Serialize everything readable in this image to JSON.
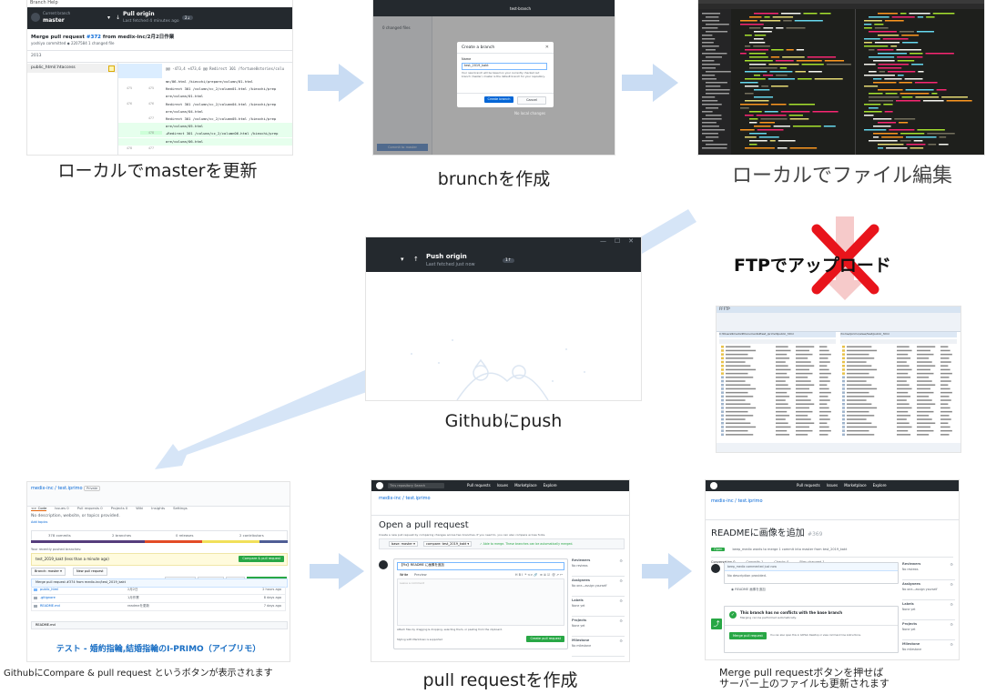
{
  "steps": [
    {
      "id": "local-master",
      "caption": "ローカルでmasterを更新"
    },
    {
      "id": "create-branch",
      "caption": "brunchを作成"
    },
    {
      "id": "edit-files",
      "caption": "ローカルでファイル編集"
    },
    {
      "id": "push",
      "caption": "Githubにpush"
    },
    {
      "id": "compare-button",
      "caption": "GithubにCompare & pull request というボタンが表示されます"
    },
    {
      "id": "create-pr",
      "caption": "pull requestを作成"
    },
    {
      "id": "merge",
      "caption_line1": "Merge pull requestボタンを押せば",
      "caption_line2": "サーバー上のファイルも更新されます"
    }
  ],
  "ftp_label": "FTPでアップロード",
  "shot1": {
    "menu": "Branch   Help",
    "current_repo_label": "Current branch",
    "branch": "master",
    "pull_origin": "Pull origin",
    "fetched": "Last fetched 4 minutes ago",
    "badge": "2↓",
    "commit_title_pre": "Merge pull request ",
    "commit_link": "#372",
    "commit_title_post": " from medix-inc/2月2日作業",
    "commit_meta": "yoshiya committed   ◆ 2207584   1 changed file",
    "year": "2013",
    "file": "public_html/.htaccess",
    "diff_header": "@@ -473,4 +473,6 @@ Redirect 301  /fortune8stories/colu",
    "diff_lines": [
      {
        "a": "",
        "b": "",
        "t": "mn/06.html /kiexchi/prepare/column/01.html"
      },
      {
        "a": "475",
        "b": "475",
        "t": "Redirect 301  /column/cc_2/column01.html /kiexchi/prep"
      },
      {
        "a": "",
        "b": "",
        "t": "are/column/01.html"
      },
      {
        "a": "476",
        "b": "476",
        "t": "Redirect 301  /column/cc_2/column04.html /kiexchi/prep"
      },
      {
        "a": "",
        "b": "",
        "t": "are/column/04.html"
      },
      {
        "a": "",
        "b": "477",
        "t": "Redirect 301  /column/cc_2/column05.html /kiexchi/prep"
      },
      {
        "a": "",
        "b": "",
        "t": "are/column/05.html"
      },
      {
        "a": "",
        "b": "478",
        "t": "+Redirect 301  /column/cc_2/column06.html /kiexchi/prep"
      },
      {
        "a": "",
        "b": "",
        "t": "are/column/06.html"
      },
      {
        "a": "478",
        "b": "477",
        "t": ""
      }
    ]
  },
  "shot2": {
    "dialog_title": "Create a branch",
    "name_label": "Name",
    "name_value": "test_2019_kakt",
    "description": "Your new branch will be based on your currently checked out branch (master). master is the default branch for your repository.",
    "create_button": "Create branch",
    "cancel_button": "Cancel",
    "branch_header": "test-branch",
    "changed_files": "0 changed files",
    "no_changes": "No local changes",
    "commit_button": "Commit to master"
  },
  "shot4": {
    "push_title": "Push origin",
    "push_sub": "Last fetched just now",
    "badge": "1↑",
    "window_controls": "—    ☐    ✕"
  },
  "shot5": {
    "repo_path": "medix-inc / test.iprimo",
    "private": "Private",
    "tabs": [
      "<> Code",
      "Issues 0",
      "Pull requests 0",
      "Projects 0",
      "Wiki",
      "Insights",
      "Settings"
    ],
    "description": "No description, website, or topics provided.",
    "add_topics": "Add topics",
    "stats": [
      "378 commits",
      "2 branches",
      "0 releases",
      "2 contributors"
    ],
    "compare_notice": "Your recently pushed branches:",
    "branch_notice": "test_2019_kakt (less than a minute ago)",
    "compare_button": "Compare & pull request",
    "branch_select": "Branch: master ▾",
    "new_pr": "New pull request",
    "file_buttons": [
      "Create new file",
      "Upload files",
      "Find file",
      "Clone or download ▾"
    ],
    "latest_commit": "Merge pull request #374 from medix-inc/test_2019_kakt",
    "files": [
      {
        "name": "public_html",
        "msg": "2月2日",
        "age": "2 hours ago"
      },
      {
        "name": ".gitignore",
        "msg": "1月作業",
        "age": "8 days ago"
      },
      {
        "name": "README.md",
        "msg": "readmeを更新",
        "age": "7 days ago"
      }
    ],
    "readme_label": "README.md",
    "banner": "テスト - 婚約指輪,結婚指輪のI-PRIMO（アイプリモ）"
  },
  "shot6": {
    "nav": [
      "Pull requests",
      "Issues",
      "Marketplace",
      "Explore"
    ],
    "search": "This repository   Search",
    "repo_path": "medix-inc / test.iprimo",
    "heading": "Open a pull request",
    "subheading": "Create a new pull request by comparing changes across two branches. If you need to, you can also compare across forks.",
    "base": "base: master ▾",
    "compare": "compare: test_2019_kakt ▾",
    "able": "✓ Able to merge. These branches can be automatically merged.",
    "title_value": "【Fix】README に画像を追加",
    "write_tab": "Write",
    "preview_tab": "Preview",
    "leave_comment": "Leave a comment",
    "attach": "Attach files by dragging & dropping, selecting them, or pasting from the clipboard.",
    "styling": "Styling with Markdown is supported",
    "create_button": "Create pull request",
    "side": [
      {
        "h": "Reviewers",
        "v": "No reviews"
      },
      {
        "h": "Assignees",
        "v": "No one—assign yourself"
      },
      {
        "h": "Labels",
        "v": "None yet"
      },
      {
        "h": "Projects",
        "v": "None yet"
      },
      {
        "h": "Milestone",
        "v": "No milestone"
      }
    ]
  },
  "shot7": {
    "nav": [
      "Pull requests",
      "Issues",
      "Marketplace",
      "Explore"
    ],
    "repo_path": "medix-inc / test.iprimo",
    "title": "READMEに画像を追加",
    "number": "#369",
    "state": "Open",
    "summary": "beep_medix wants to merge 1 commit into master from test_2019_kakt",
    "pr_tabs": [
      "Conversation 0",
      "Commits 1",
      "Checks 0",
      "Files changed 1"
    ],
    "comment_header": "beep_medix commented just now",
    "comment_body": "No description provided.",
    "commit_ref": "README 画像を追加",
    "merge_title": "This branch has no conflicts with the base branch",
    "merge_sub": "Merging can be performed automatically.",
    "merge_button": "Merge pull request",
    "merge_hint": "You can also open this in GitHub Desktop or view command line instructions.",
    "side": [
      {
        "h": "Reviewers",
        "v": "No reviews"
      },
      {
        "h": "Assignees",
        "v": "No one—assign yourself"
      },
      {
        "h": "Labels",
        "v": "None yet"
      },
      {
        "h": "Projects",
        "v": "None yet"
      },
      {
        "h": "Milestone",
        "v": "No milestone"
      }
    ]
  },
  "ftp_window": {
    "title": "FFFTP",
    "left_path": "C:¥Users¥medix¥Documents¥test_iprimo¥public_html",
    "right_path": "/home/iprimo/www/test/public_html"
  }
}
